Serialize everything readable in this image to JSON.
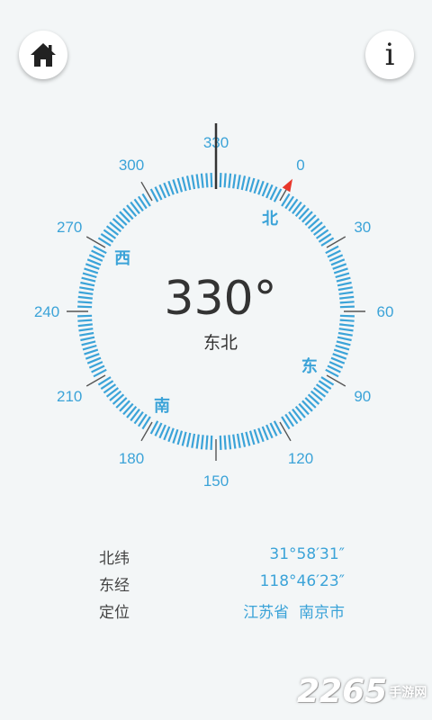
{
  "header": {
    "home_icon": "home-icon",
    "info_icon": "info-icon",
    "info_glyph": "i"
  },
  "compass": {
    "heading_deg": 330,
    "heading_label": "330°",
    "direction": "东北",
    "scale_labels": [
      "0",
      "30",
      "60",
      "90",
      "120",
      "150",
      "180",
      "210",
      "240",
      "270",
      "300",
      "330"
    ],
    "cardinals": {
      "north": "北",
      "east": "东",
      "south": "南",
      "west": "西"
    },
    "colors": {
      "accent": "#3ba3d8",
      "pointer": "#e8372b",
      "text": "#333333"
    }
  },
  "location": {
    "latitude_label": "北纬",
    "latitude_value": "31°58′31″",
    "longitude_label": "东经",
    "longitude_value": "118°46′23″",
    "position_label": "定位",
    "position_value": "江苏省  南京市"
  },
  "watermark": {
    "number": "2265",
    "text": "手游网"
  }
}
